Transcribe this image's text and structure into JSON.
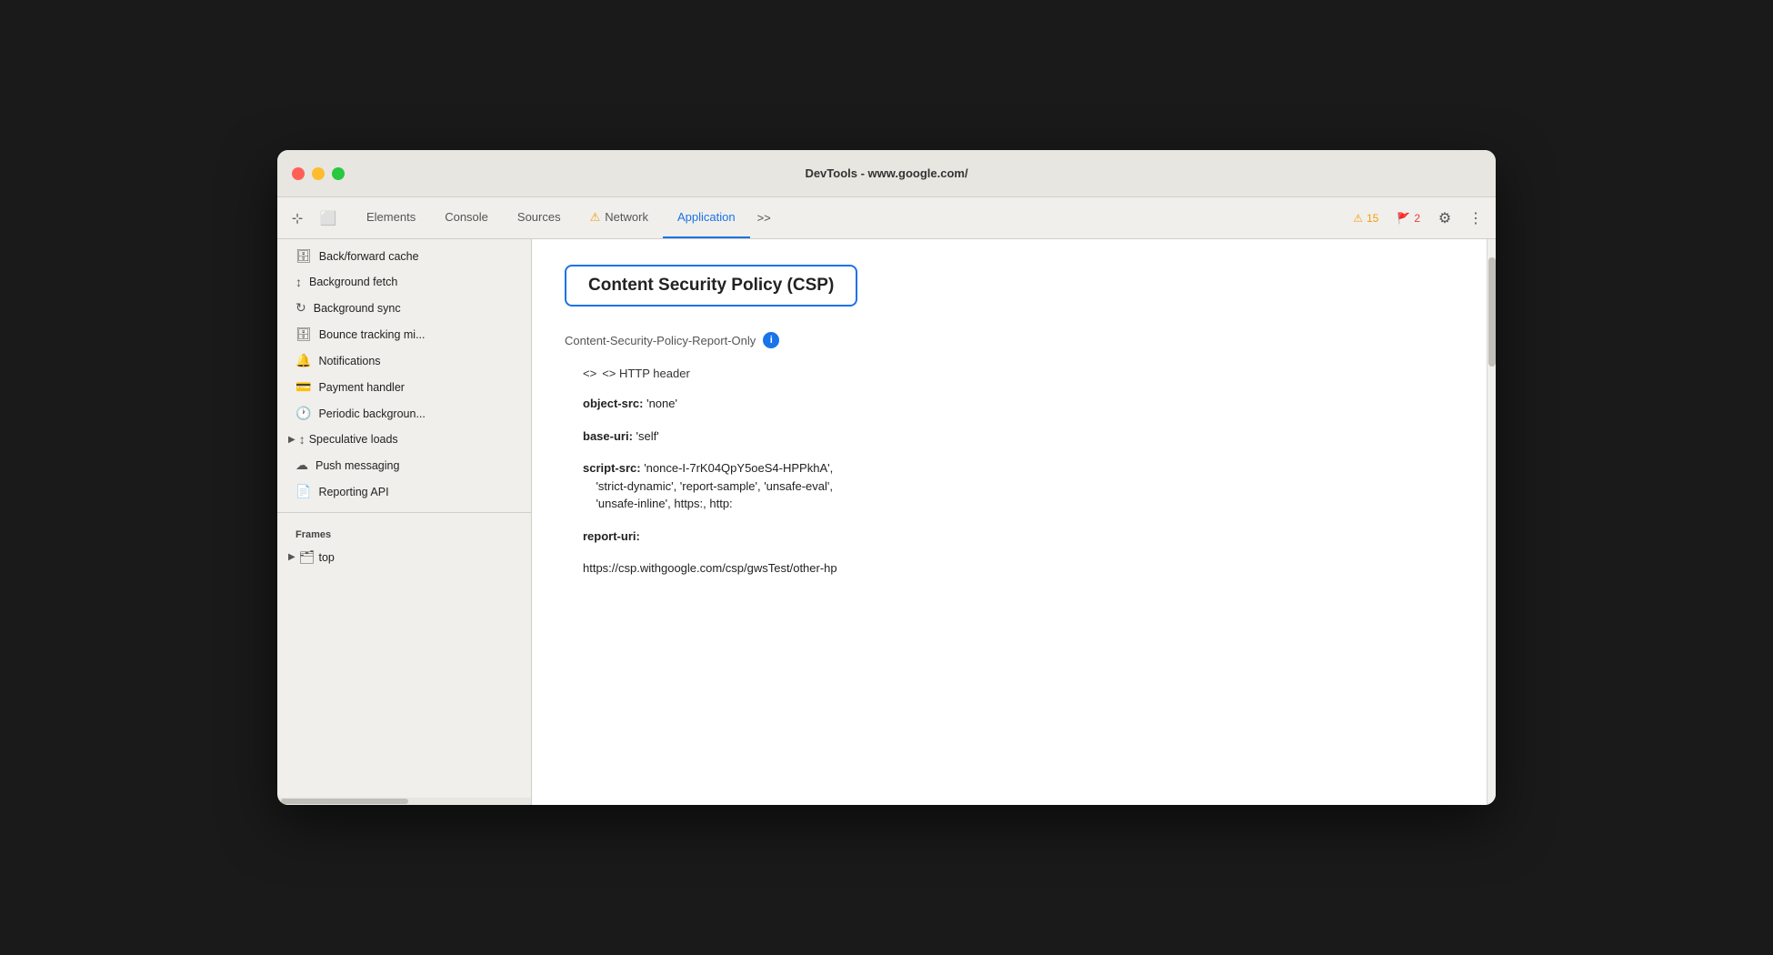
{
  "window": {
    "title": "DevTools - www.google.com/"
  },
  "tabs_bar": {
    "tabs": [
      {
        "id": "elements",
        "label": "Elements",
        "active": false,
        "has_warning": false
      },
      {
        "id": "console",
        "label": "Console",
        "active": false,
        "has_warning": false
      },
      {
        "id": "sources",
        "label": "Sources",
        "active": false,
        "has_warning": false
      },
      {
        "id": "network",
        "label": "Network",
        "active": false,
        "has_warning": true,
        "warning": "⚠"
      },
      {
        "id": "application",
        "label": "Application",
        "active": true,
        "has_warning": false
      }
    ],
    "more_label": ">>",
    "warn_count": "15",
    "error_count": "2"
  },
  "sidebar": {
    "items": [
      {
        "id": "back-forward-cache",
        "icon": "🗄",
        "label": "Back/forward cache"
      },
      {
        "id": "background-fetch",
        "icon": "↕",
        "label": "Background fetch"
      },
      {
        "id": "background-sync",
        "icon": "↻",
        "label": "Background sync"
      },
      {
        "id": "bounce-tracking",
        "icon": "🗄",
        "label": "Bounce tracking mi..."
      },
      {
        "id": "notifications",
        "icon": "🔔",
        "label": "Notifications"
      },
      {
        "id": "payment-handler",
        "icon": "💳",
        "label": "Payment handler"
      },
      {
        "id": "periodic-background",
        "icon": "🕐",
        "label": "Periodic backgroun..."
      },
      {
        "id": "speculative-loads",
        "icon": "↕",
        "label": "Speculative loads",
        "expandable": true
      },
      {
        "id": "push-messaging",
        "icon": "☁",
        "label": "Push messaging"
      },
      {
        "id": "reporting-api",
        "icon": "📄",
        "label": "Reporting API"
      }
    ],
    "frames_section": "Frames",
    "frames_item": {
      "id": "top",
      "icon": "🗂",
      "label": "top",
      "expandable": true
    }
  },
  "content": {
    "csp_title": "Content Security Policy (CSP)",
    "policy_label": "Content-Security-Policy-Report-Only",
    "http_header_label": "<> HTTP header",
    "policies": [
      {
        "key": "object-src:",
        "value": " 'none'"
      },
      {
        "key": "base-uri:",
        "value": " 'self'"
      },
      {
        "key": "script-src:",
        "value": " 'nonce-I-7rK04QpY5oeS4-HPPkhA',\n'strict-dynamic', 'report-sample', 'unsafe-eval',\n'unsafe-inline', https:, http:"
      },
      {
        "key": "report-uri:",
        "value": ""
      },
      {
        "key": "",
        "value": "https://csp.withgoogle.com/csp/gwsTest/other-hp"
      }
    ]
  },
  "icons": {
    "select_icon": "⊹",
    "device_icon": "⬜",
    "settings_icon": "⚙",
    "more_icon": "⋮",
    "warn_symbol": "⚠",
    "error_symbol": "🚩"
  }
}
